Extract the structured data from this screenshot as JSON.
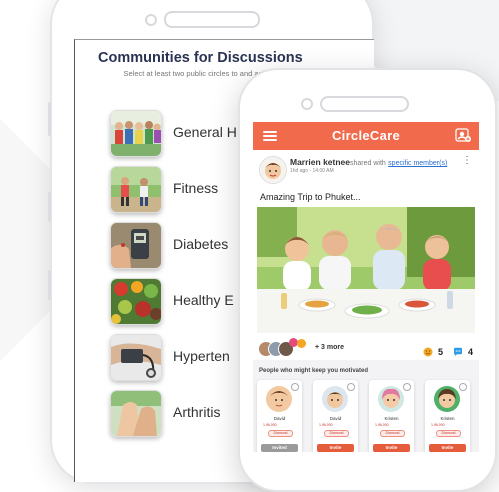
{
  "colors": {
    "brand": "#f26a4c",
    "invite_button": "#e55c3c",
    "invited_button": "#9a9a9a",
    "link": "#2a6fd1",
    "heading": "#2a3352"
  },
  "back_screen": {
    "title": "Communities for Discussions",
    "subtitle": "Select at least two public circles to and ask question",
    "communities": [
      {
        "label": "General H",
        "icon": "general-health-thumbnail"
      },
      {
        "label": "Fitness",
        "icon": "fitness-thumbnail"
      },
      {
        "label": "Diabetes",
        "icon": "diabetes-thumbnail"
      },
      {
        "label": "Healthy E",
        "icon": "healthy-eating-thumbnail"
      },
      {
        "label": "Hyperten",
        "icon": "hypertension-thumbnail"
      },
      {
        "label": "Arthritis",
        "icon": "arthritis-thumbnail"
      }
    ]
  },
  "front_screen": {
    "brand": "CircleCare",
    "post": {
      "author": "Marrien ketnee",
      "shared_text": "shared with",
      "shared_link": "specific member(s)",
      "time": "1hd ago - 14:00 AM",
      "title": "Amazing Trip to Phuket...",
      "more_reactions": "+ 3 more",
      "smile_count": "5",
      "comment_count": "4"
    },
    "people_section": {
      "title": "People who might keep you motivated",
      "people": [
        {
          "name": "David",
          "stats": "1,96,000",
          "badge": "Diamond",
          "button": "Invited"
        },
        {
          "name": "David",
          "stats": "1,96,000",
          "badge": "Diamond",
          "button": "Invite"
        },
        {
          "name": "Kristen",
          "stats": "1,96,000",
          "badge": "Diamond",
          "button": "Invite"
        },
        {
          "name": "Kristen",
          "stats": "1,96,000",
          "badge": "Diamond",
          "button": "Invite"
        }
      ]
    }
  }
}
